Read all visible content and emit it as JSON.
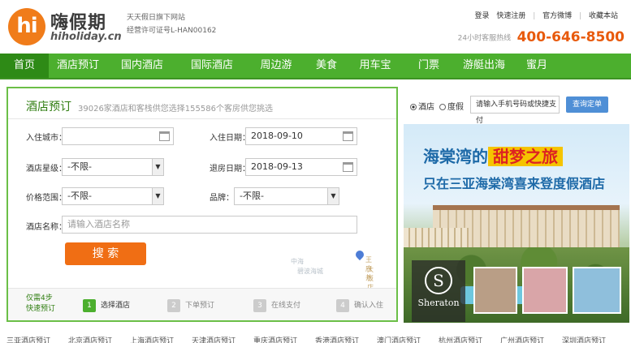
{
  "brand": {
    "logo_mark": "hi",
    "name_cn": "嗨假期",
    "domain": "hiholiday.cn",
    "tagline": "天天假日旗下网站",
    "license": "经营许可证号L-HAN00162",
    "accent_color": "#4caf2e",
    "orange_color": "#f07c1a"
  },
  "toplinks": {
    "login": "登录",
    "register": "快速注册",
    "weibo": "官方微博",
    "favorite": "收藏本站",
    "separator": "|"
  },
  "hotline": {
    "label": "24小时客服热线",
    "number": "400-646-8500"
  },
  "nav": [
    {
      "label": "首页",
      "active": true
    },
    {
      "label": "酒店预订"
    },
    {
      "label": "国内酒店"
    },
    {
      "label": "国际酒店"
    },
    {
      "label": "周边游"
    },
    {
      "label": "美食"
    },
    {
      "label": "用车宝"
    },
    {
      "label": "门票"
    },
    {
      "label": "游艇出海"
    },
    {
      "label": "蜜月"
    }
  ],
  "search": {
    "title": "酒店预订",
    "stat": "39026家酒店和客栈供您选择155586个客房供您挑选",
    "city_label": "入住城市：",
    "city_value": "",
    "checkin_label": "入住日期：",
    "checkin_value": "2018-09-10",
    "star_label": "酒店星级：",
    "star_value": "-不限-",
    "checkout_label": "退房日期：",
    "checkout_value": "2018-09-13",
    "price_label": "价格范围：",
    "price_value": "-不限-",
    "brand_label": "品牌：",
    "brand_value": "-不限-",
    "name_label": "酒店名称：",
    "name_placeholder": "请输入酒店名称",
    "submit_label": "搜 索"
  },
  "map": {
    "label1": "中海",
    "label2": "碧波海城",
    "label3": "王府井",
    "label4": "大饭店"
  },
  "steps": {
    "lead_line1": "仅需4步",
    "lead_line2": "快速预订",
    "items": [
      {
        "num": "1",
        "label": "选择酒店",
        "active": true
      },
      {
        "num": "2",
        "label": "下单预订"
      },
      {
        "num": "3",
        "label": "在线支付"
      },
      {
        "num": "4",
        "label": "确认入住"
      }
    ]
  },
  "order_query": {
    "option_hotel": "酒店",
    "option_resort": "度假",
    "input_value": "请输入手机号码或快捷支付",
    "button_label": "查询定单"
  },
  "banner": {
    "line1_prefix": "海棠湾的",
    "line1_highlight": "甜梦之旅",
    "line2": "只在三亚海棠湾喜来登度假酒店",
    "brand_mark": "S",
    "brand_name": "Sheraton"
  },
  "cities": [
    "三亚酒店预订",
    "北京酒店预订",
    "上海酒店预订",
    "天津酒店预订",
    "重庆酒店预订",
    "香港酒店预订",
    "澳门酒店预订",
    "杭州酒店预订",
    "广州酒店预订",
    "深圳酒店预订"
  ]
}
